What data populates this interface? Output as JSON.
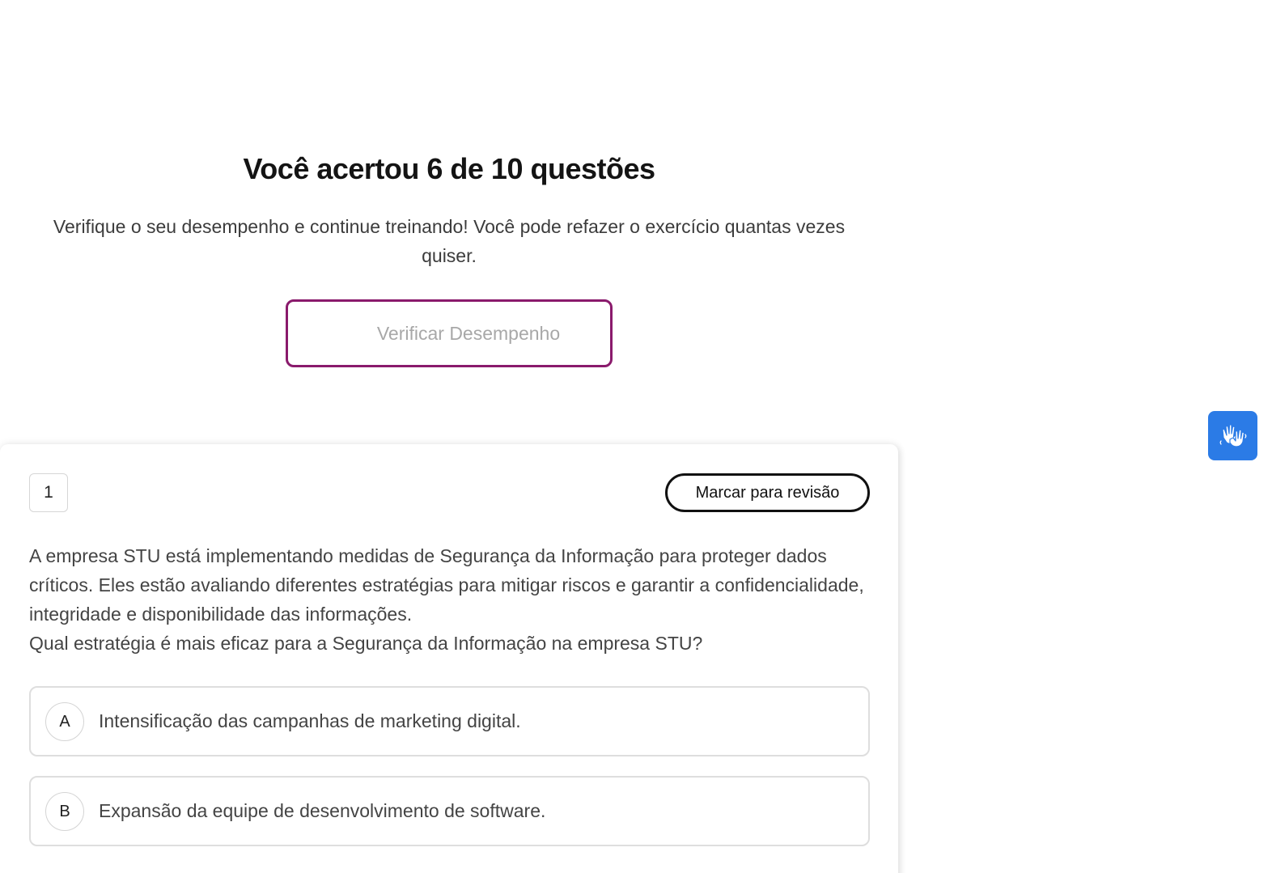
{
  "result": {
    "title": "Você acertou 6 de 10 questões",
    "subtitle": "Verifique o seu desempenho e continue treinando! Você pode refazer o exercício quantas vezes quiser.",
    "verify_button_label": "Verificar Desempenho"
  },
  "question": {
    "number": "1",
    "review_button_label": "Marcar para revisão",
    "paragraphs": [
      "A empresa STU está implementando medidas de Segurança da Informação para proteger dados críticos. Eles estão avaliando diferentes estratégias para mitigar riscos e garantir a confidencialidade, integridade e disponibilidade das informações.",
      "Qual estratégia é mais eficaz para a Segurança da Informação na empresa STU?"
    ],
    "options": [
      {
        "letter": "A",
        "text": "Intensificação das campanhas de marketing digital."
      },
      {
        "letter": "B",
        "text": "Expansão da equipe de desenvolvimento de software."
      }
    ]
  },
  "accessibility": {
    "icon": "sign-language-hands-icon",
    "color": "#2b7be6"
  },
  "colors": {
    "accent": "#8a1a6c"
  }
}
